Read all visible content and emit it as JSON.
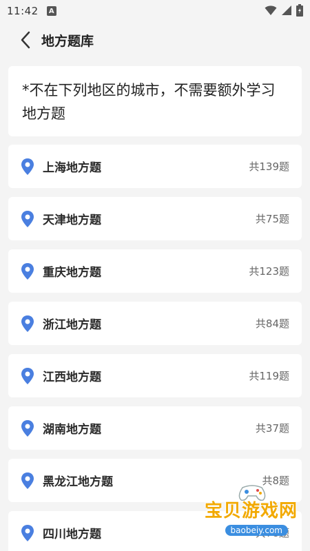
{
  "status_bar": {
    "time": "11:42",
    "notification_icon": "a-icon",
    "icons": [
      "wifi-icon",
      "signal-icon",
      "battery-icon"
    ]
  },
  "header": {
    "title": "地方题库",
    "back_icon": "chevron-left-icon"
  },
  "notice": {
    "text": "*不在下列地区的城市，不需要额外学习地方题"
  },
  "regions": [
    {
      "name": "上海地方题",
      "count": "共139题"
    },
    {
      "name": "天津地方题",
      "count": "共75题"
    },
    {
      "name": "重庆地方题",
      "count": "共123题"
    },
    {
      "name": "浙江地方题",
      "count": "共84题"
    },
    {
      "name": "江西地方题",
      "count": "共119题"
    },
    {
      "name": "湖南地方题",
      "count": "共37题"
    },
    {
      "name": "黑龙江地方题",
      "count": "共8题"
    },
    {
      "name": "四川地方题",
      "count": "共78题"
    }
  ],
  "watermark": {
    "text": "宝贝游戏网",
    "url": "baobeiy.com"
  },
  "colors": {
    "pin": "#4a7fe0",
    "background": "#f4f4f4",
    "card": "#ffffff",
    "watermark": "#f2a900"
  }
}
